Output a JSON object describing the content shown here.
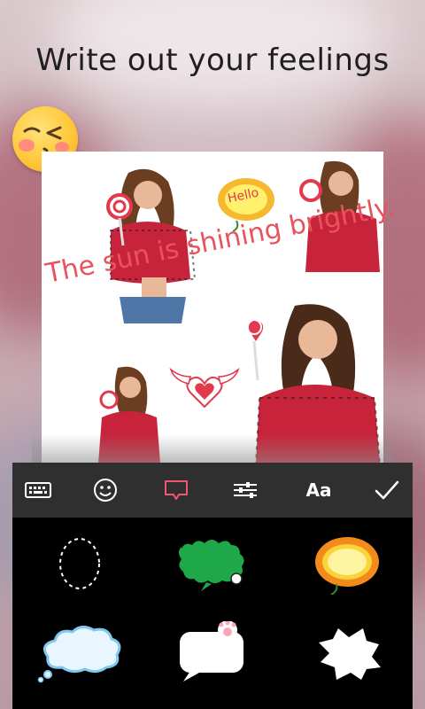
{
  "headline": "Write out your feelings",
  "collage": {
    "caption": "The sun is shining brightly.",
    "sticker_hello": "Hello"
  },
  "toolbar": {
    "items": [
      {
        "icon": "keyboard-icon",
        "active": false
      },
      {
        "icon": "smiley-icon",
        "active": false
      },
      {
        "icon": "speech-bubble-icon",
        "active": true
      },
      {
        "icon": "sliders-icon",
        "active": false
      },
      {
        "icon": "font-icon",
        "label": "Aa",
        "active": false
      },
      {
        "icon": "checkmark-icon",
        "active": false
      }
    ],
    "active_color": "#f0566e",
    "icon_color": "#ffffff"
  },
  "bubbles": [
    {
      "name": "dashed-oval-bubble"
    },
    {
      "name": "green-fuzzy-bubble"
    },
    {
      "name": "sunflower-bubble"
    },
    {
      "name": "cloud-bubble"
    },
    {
      "name": "cat-paw-bubble"
    },
    {
      "name": "spiky-white-bubble"
    }
  ]
}
